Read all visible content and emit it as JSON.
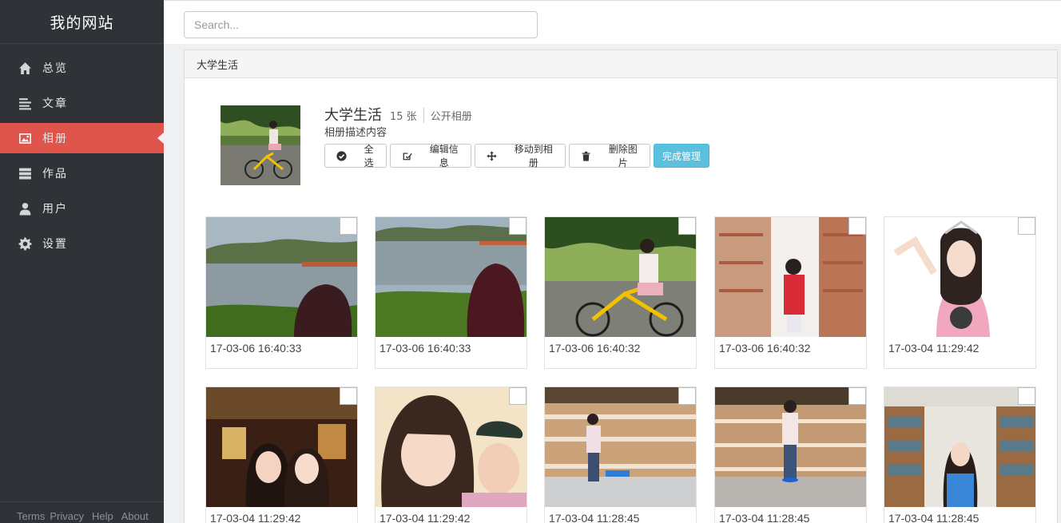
{
  "brand": "我的网站",
  "nav": [
    {
      "label": "总览",
      "icon": "home-icon"
    },
    {
      "label": "文章",
      "icon": "article-icon"
    },
    {
      "label": "相册",
      "icon": "image-icon",
      "active": true
    },
    {
      "label": "作品",
      "icon": "server-icon"
    },
    {
      "label": "用户",
      "icon": "user-icon"
    },
    {
      "label": "设置",
      "icon": "gear-icon"
    }
  ],
  "footer": {
    "terms": "Terms",
    "privacy": "Privacy",
    "help": "Help",
    "about": "About"
  },
  "search": {
    "placeholder": "Search..."
  },
  "panel": {
    "title": "大学生活"
  },
  "album": {
    "name": "大学生活",
    "count": "15 张",
    "visibility": "公开相册",
    "description": "相册描述内容"
  },
  "toolbar": {
    "select_all": "全选",
    "edit_info": "编辑信息",
    "move_to": "移动到相册",
    "delete": "删除图片",
    "done": "完成管理"
  },
  "photos": [
    {
      "date": "17-03-06 16:40:33",
      "scene": "lake"
    },
    {
      "date": "17-03-06 16:40:33",
      "scene": "lake2"
    },
    {
      "date": "17-03-06 16:40:32",
      "scene": "bike"
    },
    {
      "date": "17-03-06 16:40:32",
      "scene": "library"
    },
    {
      "date": "17-03-04 11:29:42",
      "scene": "portrait"
    },
    {
      "date": "17-03-04 11:29:42",
      "scene": "restaurant"
    },
    {
      "date": "17-03-04 11:29:42",
      "scene": "selfie"
    },
    {
      "date": "17-03-04 11:28:45",
      "scene": "atrium"
    },
    {
      "date": "17-03-04 11:28:45",
      "scene": "atrium2"
    },
    {
      "date": "17-03-04 11:28:45",
      "scene": "bookshelf"
    }
  ],
  "colors": {
    "sidebar": "#2f3338",
    "active": "#e0554b",
    "primary": "#5bc0de"
  }
}
